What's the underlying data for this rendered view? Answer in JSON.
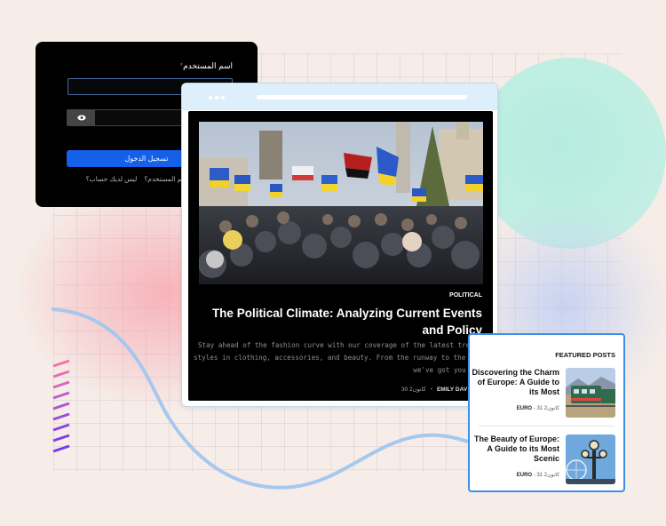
{
  "login": {
    "username_label": "اسم المستخدم",
    "required_mark": "*",
    "submit_label": "تسجيل الدخول",
    "forgot_link": "نسيت اسم المستخدم؟",
    "register_link": "ليس لديك حساب؟"
  },
  "article": {
    "category": "POLITICAL",
    "title": "The Political Climate: Analyzing Current Events and Policy",
    "excerpt_lines": [
      "Stay ahead of the fashion curve with our coverage of the latest trends",
      "styles in clothing, accessories, and beauty. From the runway to the stre",
      "we've got you cov"
    ],
    "author": "EMILY DAV",
    "date": "30 كانون2"
  },
  "featured": {
    "heading": "FEATURED POSTS",
    "posts": [
      {
        "title": "Discovering the Charm of Europe: A Guide to its Most",
        "category": "EURO",
        "date": "31 كانون2",
        "thumb": "train-icon"
      },
      {
        "title": "The Beauty of Europe: A Guide to its Most Scenic",
        "category": "EURO",
        "date": "31 كانون2",
        "thumb": "lamppost-icon"
      }
    ]
  },
  "colors": {
    "background": "#f6ede8",
    "login_button": "#1560e8",
    "featured_border": "#3d8ee8",
    "wave": "#a7c8ee",
    "stripes": [
      "#f470a8",
      "#7b3cf0"
    ]
  }
}
